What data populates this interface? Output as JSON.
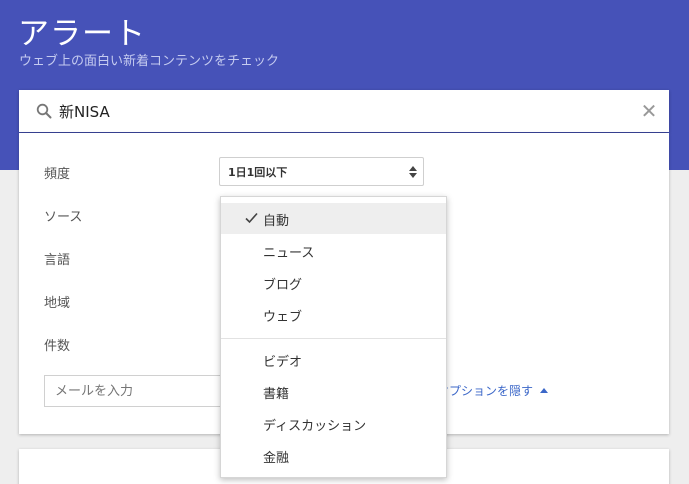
{
  "header": {
    "title": "アラート",
    "subtitle": "ウェブ上の面白い新着コンテンツをチェック"
  },
  "search": {
    "value": "新NISA",
    "search_icon": "search-icon",
    "clear_icon": "close-icon"
  },
  "options": {
    "frequency_label": "頻度",
    "frequency_value": "1日1回以下",
    "source_label": "ソース",
    "language_label": "言語",
    "region_label": "地域",
    "count_label": "件数"
  },
  "email": {
    "placeholder": "メールを入力"
  },
  "hide_options": {
    "label": "オプションを隠す",
    "icon": "caret-up-icon"
  },
  "source_dropdown": {
    "selected": "自動",
    "items": [
      "自動",
      "ニュース",
      "ブログ",
      "ウェブ",
      "ビデオ",
      "書籍",
      "ディスカッション",
      "金融"
    ]
  },
  "colors": {
    "header_bg": "#4652b8",
    "link": "#3b67c8"
  }
}
